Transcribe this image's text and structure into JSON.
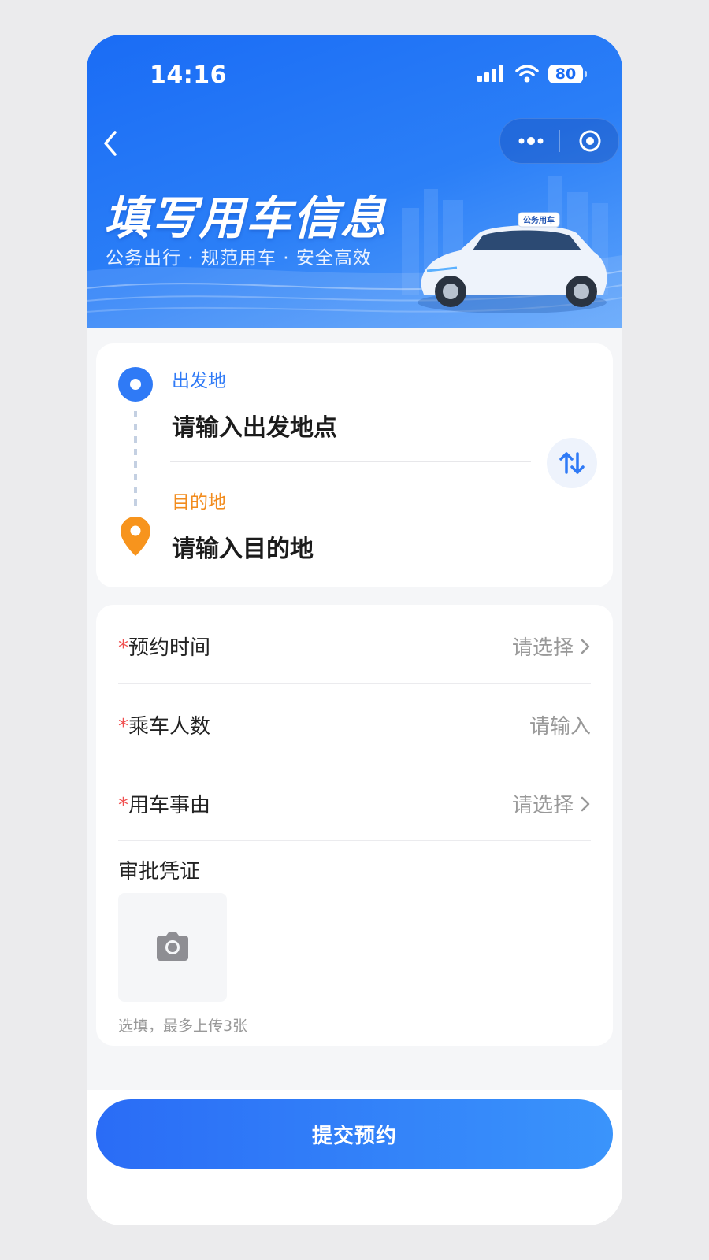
{
  "status_bar": {
    "time": "14:16",
    "battery": "80"
  },
  "hero": {
    "title": "填写用车信息",
    "subtitle": "公务出行 · 规范用车 · 安全高效",
    "car_badge": "公务用车"
  },
  "route": {
    "origin_label": "出发地",
    "origin_placeholder": "请输入出发地点",
    "destination_label": "目的地",
    "destination_placeholder": "请输入目的地"
  },
  "form": {
    "required_mark": "*",
    "rows": [
      {
        "label": "预约时间",
        "value": "请选择"
      },
      {
        "label": "乘车人数",
        "value": "请输入"
      },
      {
        "label": "用车事由",
        "value": "请选择"
      }
    ],
    "proof_label": "审批凭证",
    "upload_hint": "选填，最多上传3张"
  },
  "submit_label": "提交预约",
  "colors": {
    "primary": "#2f7af6",
    "destination": "#f28c1e",
    "required": "#f05050"
  }
}
